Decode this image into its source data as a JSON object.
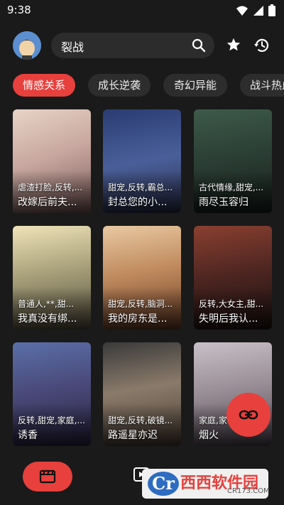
{
  "status_bar": {
    "time": "9:38"
  },
  "search": {
    "value": "裂战"
  },
  "tabs": [
    "情感关系",
    "成长逆袭",
    "奇幻异能",
    "战斗热血"
  ],
  "dramas": [
    {
      "tags": "虐渣打脸,反转,...",
      "title": "改嫁后前夫..."
    },
    {
      "tags": "甜宠,反转,霸总...",
      "title": "封总您的小..."
    },
    {
      "tags": "古代情缘,甜宠,...",
      "title": "雨尽玉容归"
    },
    {
      "tags": "普通人,**,甜...",
      "title": "我真没有绑..."
    },
    {
      "tags": "甜宠,反转,脑洞...",
      "title": "我的房东是..."
    },
    {
      "tags": "反转,大女主,甜...",
      "title": "失明后我认..."
    },
    {
      "tags": "反转,甜宠,家庭,...",
      "title": "诱香"
    },
    {
      "tags": "甜宠,反转,破镜...",
      "title": "路遥星亦迟"
    },
    {
      "tags": "家庭,家",
      "title": "烟火"
    }
  ],
  "watermark": {
    "brand": "西西软件园",
    "url": "CR173.COM",
    "logo": "Cr"
  },
  "colors": {
    "accent": "#e8403c",
    "background": "#1a1a1a",
    "surface": "#2c2c2c"
  },
  "icons": {
    "search": "search-icon",
    "favorite": "star-icon",
    "history": "history-icon",
    "fab": "link-icon",
    "home": "clapperboard-icon",
    "play": "play-icon"
  }
}
